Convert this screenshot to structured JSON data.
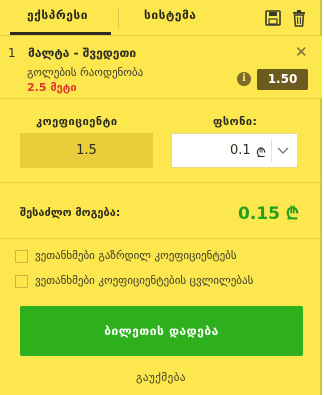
{
  "tabs": {
    "express": "ექსპრესი",
    "system": "სისტემა"
  },
  "icons": {
    "save": "save-icon",
    "trash": "trash-icon",
    "info": "info-icon",
    "close": "close-icon"
  },
  "bet": {
    "number": "1",
    "match": "მალტა - შვედეთი",
    "market": "გოლების რაოდენობა",
    "pick": "2.5 მეტი",
    "odds": "1.50",
    "close_symbol": "✕",
    "info_symbol": "i"
  },
  "stake": {
    "coef_label": "კოეფიციენტი",
    "coef_value": "1.5",
    "amount_label": "ფსონი:",
    "amount_value": "0.1",
    "currency": "₾"
  },
  "win": {
    "label": "შესაძლო მოგება:",
    "value": "0.15 ₾"
  },
  "options": [
    {
      "label": "ვეთანხმები გაზრდილ კოეფიციენტებს",
      "checked": false
    },
    {
      "label": "ვეთანხმები კოეფიციენტების ცვლილებას",
      "checked": false
    }
  ],
  "actions": {
    "place_bet": "ბილეთის დადება",
    "cancel": "გაუქმება"
  },
  "colors": {
    "panel_bg": "#fde74e",
    "odds_badge": "#6c5b1e",
    "win_value": "#23a11f",
    "place_btn": "#2db01c",
    "pick_text": "#e0362f"
  }
}
